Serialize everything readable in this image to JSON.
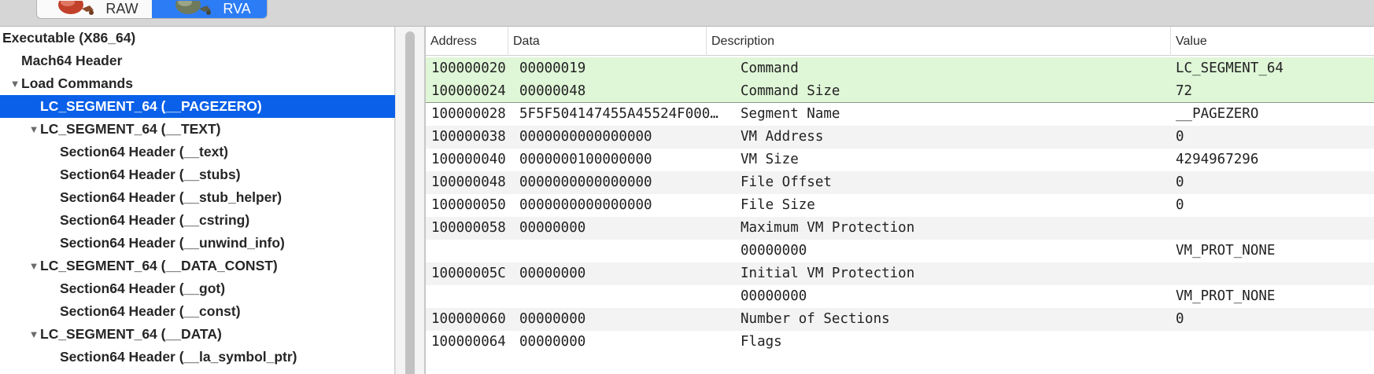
{
  "toolbar": {
    "modes": [
      {
        "label": "RAW",
        "icon": "raw-mode-icon",
        "active": false
      },
      {
        "label": "RVA",
        "icon": "rva-mode-icon",
        "active": true
      }
    ]
  },
  "tree": [
    {
      "label": "Executable  (X86_64)",
      "level": 0,
      "expander": ""
    },
    {
      "label": "Mach64 Header",
      "level": 1,
      "expander": ""
    },
    {
      "label": "Load Commands",
      "level": 1,
      "expander": "▼"
    },
    {
      "label": "LC_SEGMENT_64 (__PAGEZERO)",
      "level": 2,
      "expander": "",
      "selected": true
    },
    {
      "label": "LC_SEGMENT_64 (__TEXT)",
      "level": 2,
      "expander": "▼"
    },
    {
      "label": "Section64 Header (__text)",
      "level": 3,
      "expander": ""
    },
    {
      "label": "Section64 Header (__stubs)",
      "level": 3,
      "expander": ""
    },
    {
      "label": "Section64 Header (__stub_helper)",
      "level": 3,
      "expander": ""
    },
    {
      "label": "Section64 Header (__cstring)",
      "level": 3,
      "expander": ""
    },
    {
      "label": "Section64 Header (__unwind_info)",
      "level": 3,
      "expander": ""
    },
    {
      "label": "LC_SEGMENT_64 (__DATA_CONST)",
      "level": 2,
      "expander": "▼"
    },
    {
      "label": "Section64 Header (__got)",
      "level": 3,
      "expander": ""
    },
    {
      "label": "Section64 Header (__const)",
      "level": 3,
      "expander": ""
    },
    {
      "label": "LC_SEGMENT_64 (__DATA)",
      "level": 2,
      "expander": "▼"
    },
    {
      "label": "Section64 Header (__la_symbol_ptr)",
      "level": 3,
      "expander": ""
    }
  ],
  "table": {
    "columns": {
      "address": "Address",
      "data": "Data",
      "description": "Description",
      "value": "Value"
    },
    "rows": [
      {
        "address": "100000020",
        "data": "00000019",
        "description": "Command",
        "value": "LC_SEGMENT_64",
        "highlight": true
      },
      {
        "address": "100000024",
        "data": "00000048",
        "description": "Command Size",
        "value": "72",
        "highlight": true
      },
      {
        "address": "100000028",
        "data": "5F5F504147455A45524F000…",
        "description": "Segment Name",
        "value": "__PAGEZERO"
      },
      {
        "address": "100000038",
        "data": "0000000000000000",
        "description": "VM Address",
        "value": "0"
      },
      {
        "address": "100000040",
        "data": "0000000100000000",
        "description": "VM Size",
        "value": "4294967296"
      },
      {
        "address": "100000048",
        "data": "0000000000000000",
        "description": "File Offset",
        "value": "0"
      },
      {
        "address": "100000050",
        "data": "0000000000000000",
        "description": "File Size",
        "value": "0"
      },
      {
        "address": "100000058",
        "data": "00000000",
        "description": "Maximum VM Protection",
        "value": ""
      },
      {
        "address": "",
        "data": "",
        "description": "00000000",
        "value": "VM_PROT_NONE"
      },
      {
        "address": "10000005C",
        "data": "00000000",
        "description": "Initial VM Protection",
        "value": ""
      },
      {
        "address": "",
        "data": "",
        "description": "00000000",
        "value": "VM_PROT_NONE"
      },
      {
        "address": "100000060",
        "data": "00000000",
        "description": "Number of Sections",
        "value": "0"
      },
      {
        "address": "100000064",
        "data": "00000000",
        "description": "Flags",
        "value": ""
      }
    ]
  },
  "colors": {
    "selection": "#0a60e8",
    "highlight_row": "#dff6d7",
    "segment_active": "#2c7cf5"
  }
}
